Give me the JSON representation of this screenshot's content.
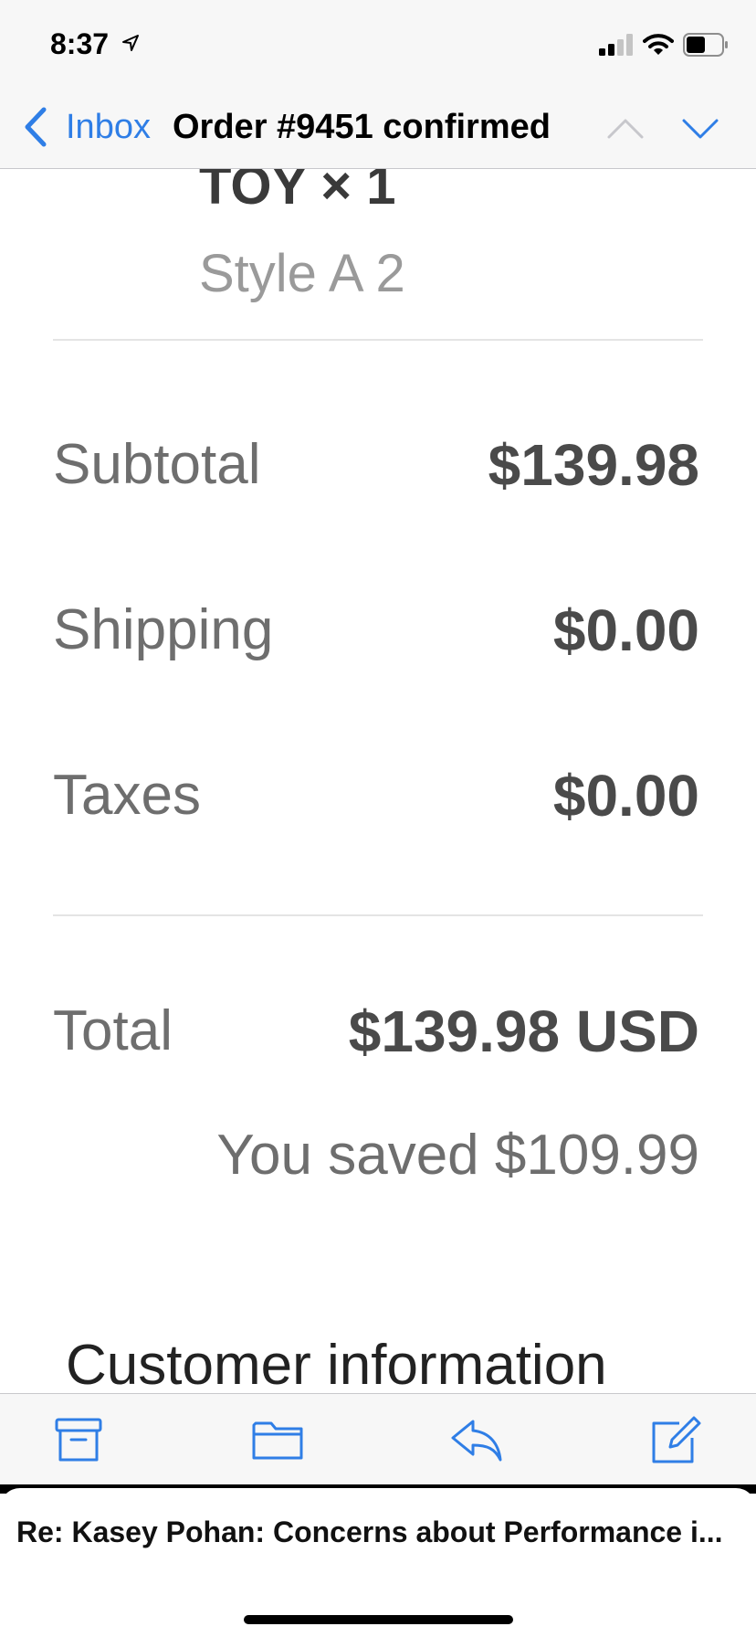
{
  "status_bar": {
    "time": "8:37",
    "location_icon": "location-arrow-icon",
    "signal_icon": "cellular-signal-icon",
    "wifi_icon": "wifi-icon",
    "battery_icon": "battery-icon"
  },
  "nav": {
    "back_label": "Inbox",
    "title": "Order #9451 confirmed",
    "up_icon": "chevron-up-icon",
    "down_icon": "chevron-down-icon"
  },
  "order": {
    "item_title": "TOY × 1",
    "item_style": "Style A 2",
    "rows": [
      {
        "label": "Subtotal",
        "value": "$139.98"
      },
      {
        "label": "Shipping",
        "value": "$0.00"
      },
      {
        "label": "Taxes",
        "value": "$0.00"
      }
    ],
    "total_label": "Total",
    "total_value": "$139.98 USD",
    "saved_text": "You saved $109.99",
    "next_section": "Customer information"
  },
  "toolbar": {
    "archive_icon": "archive-icon",
    "folder_icon": "folder-icon",
    "reply_icon": "reply-icon",
    "compose_icon": "compose-icon"
  },
  "draft": {
    "subject": "Re: Kasey Pohan: Concerns about Performance i..."
  },
  "colors": {
    "accent": "#2f7ee6",
    "bar_bg": "#f7f7f7",
    "label_gray": "#6e6e6e",
    "value_dark": "#4a4a4a"
  }
}
